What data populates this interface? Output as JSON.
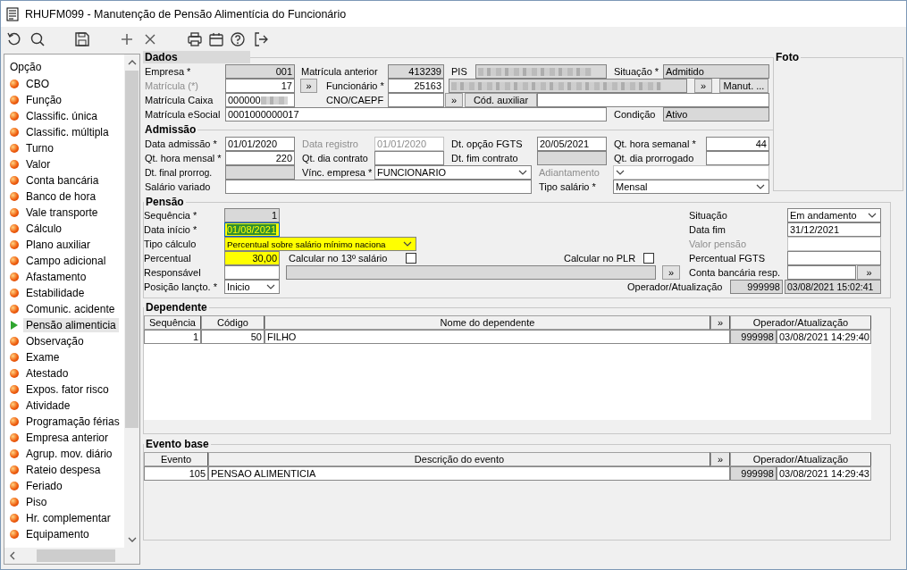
{
  "window": {
    "title": "RHUFM099 - Manutenção de Pensão Alimentícia do Funcionário"
  },
  "sidebar": {
    "header": "Opção",
    "items": [
      {
        "label": "CBO",
        "selected": false
      },
      {
        "label": "Função",
        "selected": false
      },
      {
        "label": "Classific. única",
        "selected": false
      },
      {
        "label": "Classific. múltipla",
        "selected": false
      },
      {
        "label": "Turno",
        "selected": false
      },
      {
        "label": "Valor",
        "selected": false
      },
      {
        "label": "Conta bancária",
        "selected": false
      },
      {
        "label": "Banco de hora",
        "selected": false
      },
      {
        "label": "Vale transporte",
        "selected": false
      },
      {
        "label": "Cálculo",
        "selected": false
      },
      {
        "label": "Plano auxiliar",
        "selected": false
      },
      {
        "label": "Campo adicional",
        "selected": false
      },
      {
        "label": "Afastamento",
        "selected": false
      },
      {
        "label": "Estabilidade",
        "selected": false
      },
      {
        "label": "Comunic. acidente",
        "selected": false
      },
      {
        "label": "Pensão alimenticia",
        "selected": true
      },
      {
        "label": "Observação",
        "selected": false
      },
      {
        "label": "Exame",
        "selected": false
      },
      {
        "label": "Atestado",
        "selected": false
      },
      {
        "label": "Expos. fator risco",
        "selected": false
      },
      {
        "label": "Atividade",
        "selected": false
      },
      {
        "label": "Programação férias",
        "selected": false
      },
      {
        "label": "Empresa anterior",
        "selected": false
      },
      {
        "label": "Agrup. mov. diário",
        "selected": false
      },
      {
        "label": "Rateio despesa",
        "selected": false
      },
      {
        "label": "Feriado",
        "selected": false
      },
      {
        "label": "Piso",
        "selected": false
      },
      {
        "label": "Hr. complementar",
        "selected": false
      },
      {
        "label": "Equipamento",
        "selected": false
      }
    ]
  },
  "dados": {
    "title": "Dados",
    "lines": [
      {
        "items": [
          {
            "kind": "label",
            "text": "Empresa *",
            "disabled": false
          },
          {
            "kind": "number",
            "value": "001",
            "readonly": true,
            "disabled": false
          },
          {
            "kind": "label",
            "text": "Matrícula anterior",
            "disabled": false
          },
          {
            "kind": "number",
            "value": "413239",
            "readonly": true,
            "disabled": false
          },
          {
            "kind": "label",
            "text": "PIS",
            "disabled": false
          },
          {
            "kind": "field",
            "readonly": true,
            "disabled": false,
            "masked": true
          },
          {
            "kind": "label",
            "text": "Situação *",
            "disabled": false
          },
          {
            "kind": "field",
            "value": "Admitido",
            "readonly": true,
            "disabled": false
          }
        ]
      },
      {
        "items": [
          {
            "kind": "label",
            "text": "Matrícula (*)",
            "disabled": true
          },
          {
            "kind": "number",
            "value": "17",
            "readonly": false,
            "disabled": false
          },
          {
            "kind": "button",
            "text": "»"
          },
          {
            "kind": "label",
            "text": "Funcionário *",
            "disabled": false
          },
          {
            "kind": "number",
            "value": "25163",
            "readonly": false,
            "disabled": false
          },
          {
            "kind": "field",
            "readonly": true,
            "disabled": false,
            "masked": true
          },
          {
            "kind": "button",
            "text": "»"
          },
          {
            "kind": "button",
            "text": "Manut. ..."
          }
        ]
      },
      {
        "items": [
          {
            "kind": "label",
            "text": "Matrícula Caixa",
            "disabled": false
          },
          {
            "kind": "field",
            "value": "000000",
            "readonly": false,
            "disabled": false,
            "masked": true
          },
          {
            "kind": "label",
            "text": "CNO/CAEPF",
            "disabled": false
          },
          {
            "kind": "field",
            "readonly": false,
            "disabled": false
          },
          {
            "kind": "button",
            "text": "»"
          },
          {
            "kind": "button",
            "text": "Cód. auxiliar"
          },
          {
            "kind": "field",
            "readonly": false,
            "disabled": false
          }
        ]
      },
      {
        "items": [
          {
            "kind": "label",
            "text": "Matrícula eSocial",
            "disabled": false
          },
          {
            "kind": "field",
            "value": "0001000000017",
            "readonly": false,
            "disabled": false
          },
          {
            "kind": "label",
            "text": "Condição",
            "disabled": false
          },
          {
            "kind": "field",
            "value": "Ativo",
            "readonly": true,
            "disabled": false
          }
        ]
      }
    ]
  },
  "admissao": {
    "title": "Admissão",
    "lines": [
      {
        "items": [
          {
            "kind": "label",
            "text": "Data admissão *",
            "disabled": false
          },
          {
            "kind": "field",
            "value": "01/01/2020",
            "readonly": false,
            "disabled": false
          },
          {
            "kind": "label",
            "text": "Data registro",
            "disabled": true
          },
          {
            "kind": "field",
            "value": "01/01/2020",
            "readonly": false,
            "disabled": true
          },
          {
            "kind": "label",
            "text": "Dt. opção FGTS",
            "disabled": false
          },
          {
            "kind": "field",
            "value": "20/05/2021",
            "readonly": false,
            "disabled": false
          },
          {
            "kind": "label",
            "text": "Qt. hora semanal *",
            "disabled": false
          },
          {
            "kind": "number",
            "value": "44",
            "readonly": false,
            "disabled": false
          }
        ]
      },
      {
        "items": [
          {
            "kind": "label",
            "text": "Qt. hora mensal *",
            "disabled": false
          },
          {
            "kind": "number",
            "value": "220",
            "readonly": false,
            "disabled": false
          },
          {
            "kind": "label",
            "text": "Qt. dia contrato",
            "disabled": false
          },
          {
            "kind": "field",
            "readonly": false,
            "disabled": false
          },
          {
            "kind": "label",
            "text": "Dt. fim contrato",
            "disabled": false
          },
          {
            "kind": "field",
            "readonly": true,
            "disabled": false
          },
          {
            "kind": "label",
            "text": "Qt. dia prorrogado",
            "disabled": false
          },
          {
            "kind": "number",
            "readonly": false,
            "disabled": false
          }
        ]
      },
      {
        "items": [
          {
            "kind": "label",
            "text": "Dt. final prorrog.",
            "disabled": false
          },
          {
            "kind": "field",
            "readonly": true,
            "disabled": false
          },
          {
            "kind": "label",
            "text": "Vínc. empresa *",
            "disabled": false
          },
          {
            "kind": "select",
            "value": "FUNCIONARIO",
            "readonly": false,
            "disabled": false
          },
          {
            "kind": "label",
            "text": "Adiantamento",
            "disabled": true
          },
          {
            "kind": "select",
            "readonly": false,
            "disabled": true
          }
        ]
      },
      {
        "items": [
          {
            "kind": "label",
            "text": "Salário variado",
            "disabled": false
          },
          {
            "kind": "field",
            "readonly": false,
            "disabled": false
          },
          {
            "kind": "label",
            "text": "Tipo salário *",
            "disabled": false
          },
          {
            "kind": "select",
            "value": "Mensal",
            "readonly": false,
            "disabled": false
          }
        ]
      }
    ]
  },
  "foto": {
    "title": "Foto"
  },
  "pensao": {
    "title": "Pensão",
    "lines": [
      {
        "items": [
          {
            "kind": "label",
            "text": "Sequência *",
            "disabled": false
          },
          {
            "kind": "number",
            "value": "1",
            "readonly": true,
            "disabled": false,
            "highlighted": false,
            "focused": false
          },
          {
            "kind": "label",
            "text": "Situação",
            "disabled": false
          },
          {
            "kind": "select",
            "value": "Em andamento",
            "readonly": false,
            "disabled": false,
            "highlighted": false,
            "focused": false
          }
        ]
      },
      {
        "items": [
          {
            "kind": "label",
            "text": "Data início *",
            "disabled": false
          },
          {
            "kind": "field",
            "value": "01/08/2021",
            "readonly": false,
            "disabled": false,
            "highlighted": true,
            "focused": true
          },
          {
            "kind": "label",
            "text": "Data fim",
            "disabled": false
          },
          {
            "kind": "field",
            "value": "31/12/2021",
            "readonly": false,
            "disabled": false,
            "highlighted": false,
            "focused": false
          }
        ]
      },
      {
        "items": [
          {
            "kind": "label",
            "text": "Tipo cálculo",
            "disabled": false
          },
          {
            "kind": "select",
            "value": "Percentual sobre salário mínimo naciona",
            "readonly": false,
            "disabled": false,
            "highlighted": true,
            "focused": false
          },
          {
            "kind": "label",
            "text": "Valor pensão",
            "disabled": true
          },
          {
            "kind": "field",
            "readonly": false,
            "disabled": true,
            "highlighted": false,
            "focused": false
          }
        ]
      },
      {
        "items": [
          {
            "kind": "label",
            "text": "Percentual",
            "disabled": false
          },
          {
            "kind": "number",
            "value": "30,00",
            "readonly": false,
            "disabled": false,
            "highlighted": true,
            "focused": false
          },
          {
            "kind": "label",
            "text": "Calcular no 13º salário",
            "disabled": false
          },
          {
            "kind": "checkbox",
            "checked": false
          },
          {
            "kind": "label",
            "text": "Calcular no PLR",
            "disabled": false
          },
          {
            "kind": "checkbox",
            "checked": false
          },
          {
            "kind": "label",
            "text": "Percentual FGTS",
            "disabled": false
          },
          {
            "kind": "field",
            "readonly": false,
            "disabled": false,
            "highlighted": false,
            "focused": false
          }
        ]
      },
      {
        "items": [
          {
            "kind": "label",
            "text": "Responsável",
            "disabled": false
          },
          {
            "kind": "field",
            "readonly": false,
            "disabled": false,
            "highlighted": false,
            "focused": false
          },
          {
            "kind": "field",
            "readonly": true,
            "disabled": false,
            "highlighted": false,
            "focused": false
          },
          {
            "kind": "button",
            "text": "»"
          },
          {
            "kind": "label",
            "text": "Conta bancária resp.",
            "disabled": false
          },
          {
            "kind": "field",
            "readonly": false,
            "disabled": false,
            "highlighted": false,
            "focused": false
          },
          {
            "kind": "button",
            "text": "»"
          }
        ]
      },
      {
        "items": [
          {
            "kind": "label",
            "text": "Posição lançto. *",
            "disabled": false
          },
          {
            "kind": "select",
            "value": "Inicio",
            "readonly": false,
            "disabled": false,
            "highlighted": false,
            "focused": false
          },
          {
            "kind": "label",
            "text": "Operador/Atualização",
            "disabled": false
          },
          {
            "kind": "number",
            "value": "999998",
            "readonly": true,
            "disabled": false,
            "highlighted": false,
            "focused": false
          },
          {
            "kind": "field",
            "value": "03/08/2021 15:02:41",
            "readonly": true,
            "disabled": false,
            "highlighted": false,
            "focused": false
          }
        ]
      }
    ]
  },
  "dependente": {
    "title": "Dependente",
    "columns": [
      "Sequência",
      "Código",
      "Nome do dependente",
      "»",
      "Operador/Atualização"
    ],
    "rows": [
      {
        "cells": [
          "1",
          "50",
          "FILHO"
        ],
        "operador": "999998",
        "atualizacao": "03/08/2021 14:29:40"
      }
    ]
  },
  "evento_base": {
    "title": "Evento base",
    "columns": [
      "Evento",
      "Descrição do evento",
      "»",
      "Operador/Atualização"
    ],
    "rows": [
      {
        "cells": [
          "105",
          "PENSAO ALIMENTICIA"
        ],
        "operador": "999998",
        "atualizacao": "03/08/2021 14:29:43"
      }
    ]
  }
}
